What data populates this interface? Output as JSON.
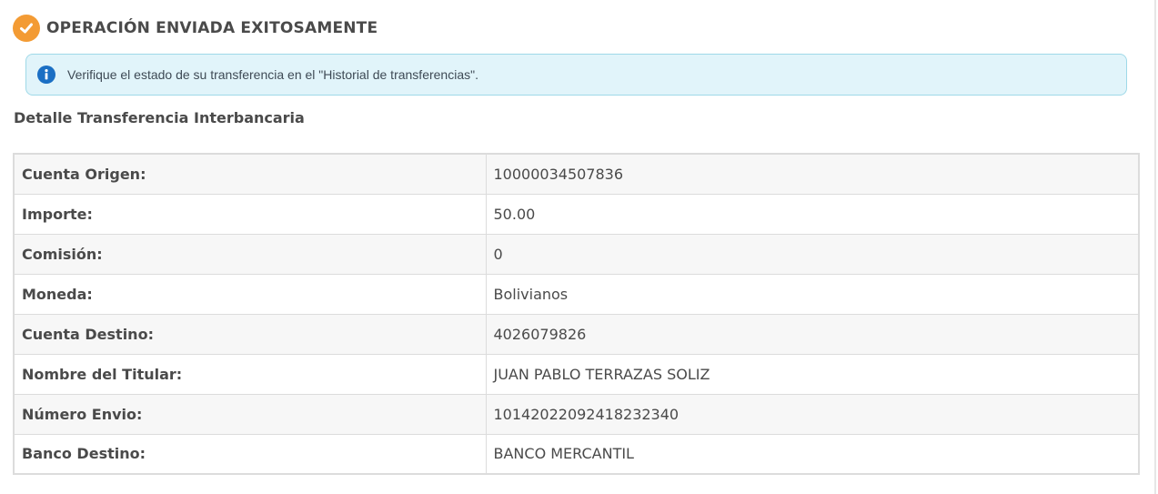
{
  "status": {
    "title": "OPERACIÓN ENVIADA EXITOSAMENTE",
    "icon": "check-circle-icon",
    "icon_color": "#f39b34"
  },
  "alert": {
    "icon": "info-icon",
    "icon_color": "#1b6fc4",
    "text": "Verifique el estado de su transferencia en el \"Historial de transferencias\"."
  },
  "detail": {
    "title": "Detalle Transferencia Interbancaria",
    "rows": [
      {
        "label": "Cuenta Origen:",
        "value": "10000034507836"
      },
      {
        "label": "Importe:",
        "value": "50.00"
      },
      {
        "label": "Comisión:",
        "value": "0"
      },
      {
        "label": "Moneda:",
        "value": "Bolivianos"
      },
      {
        "label": "Cuenta Destino:",
        "value": "4026079826"
      },
      {
        "label": "Nombre del Titular:",
        "value": "JUAN PABLO TERRAZAS SOLIZ"
      },
      {
        "label": "Número Envio:",
        "value": "10142022092418232340"
      },
      {
        "label": "Banco Destino:",
        "value": "BANCO MERCANTIL"
      }
    ]
  }
}
